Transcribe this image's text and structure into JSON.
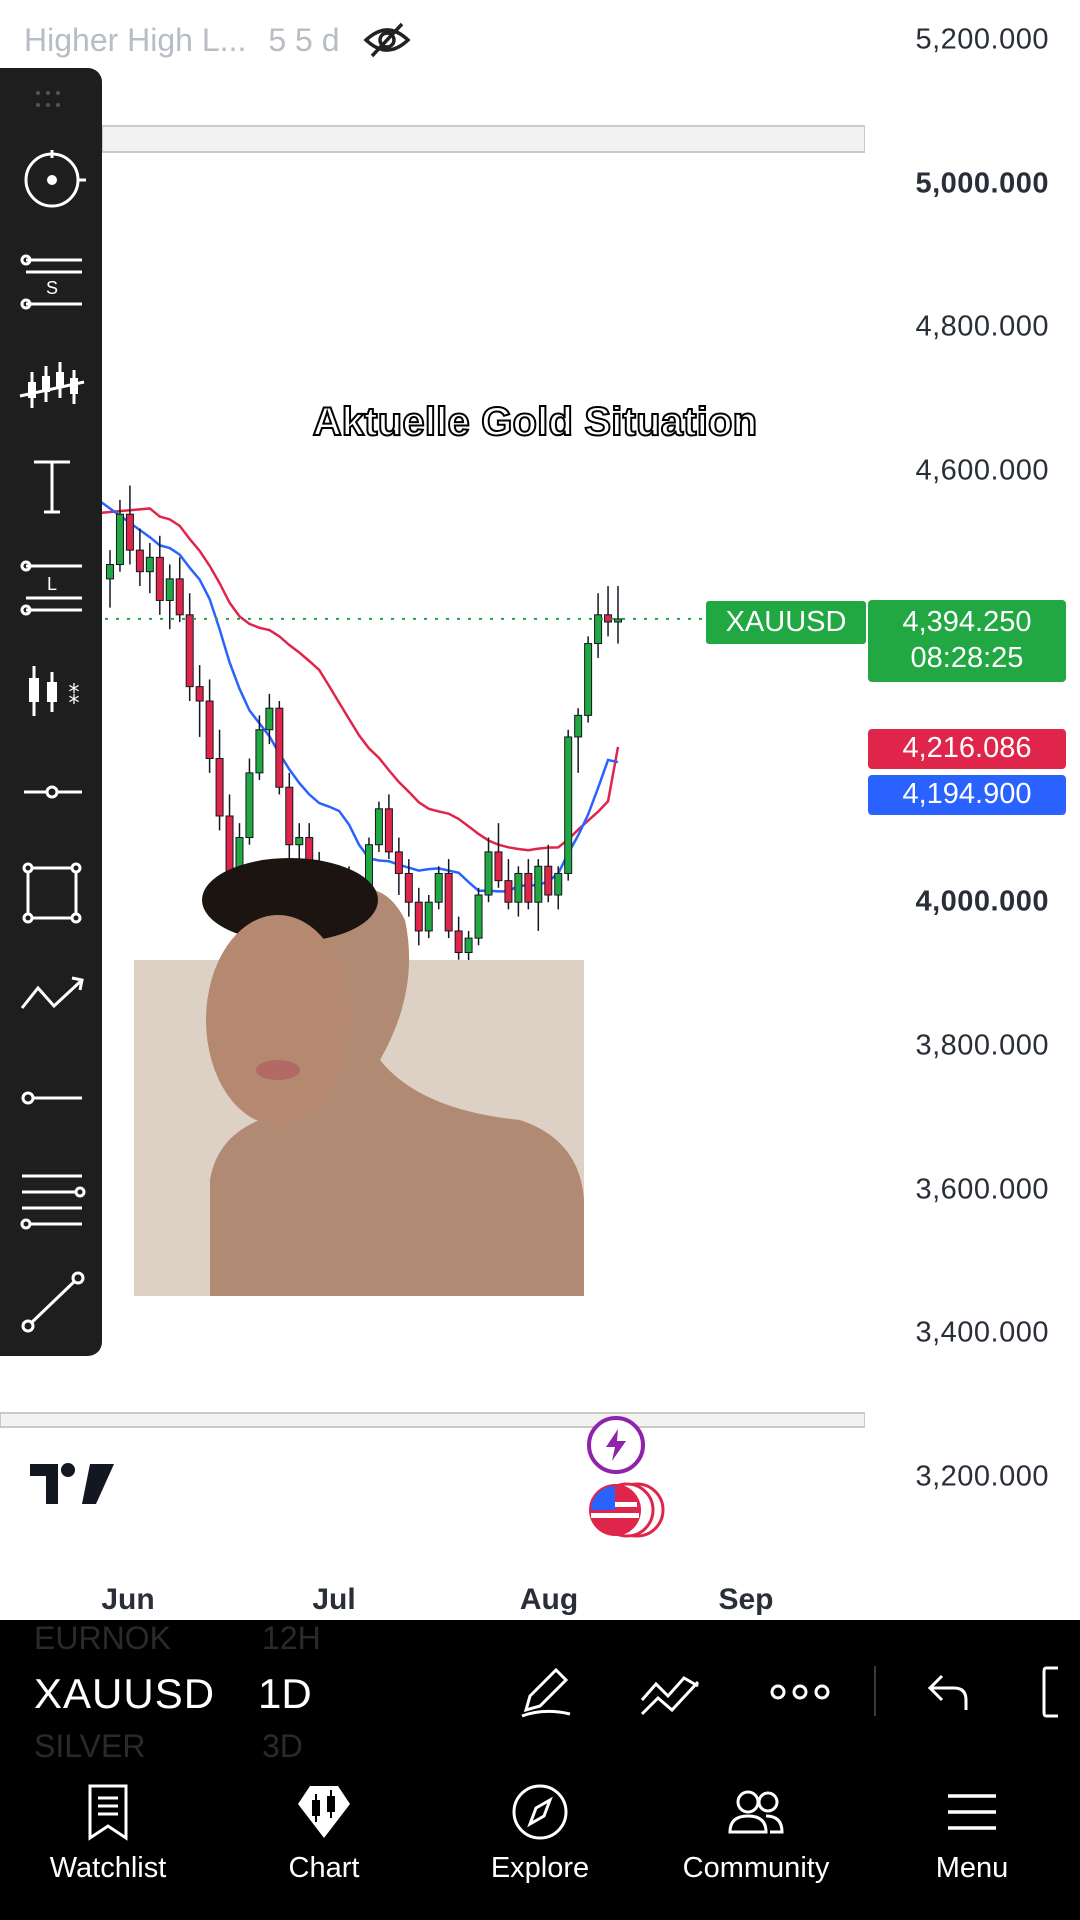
{
  "legend": {
    "name": "Higher High L...",
    "params": "5 5 d",
    "icon": "eye-off-icon"
  },
  "overlay_title": "Aktuelle Gold Situation",
  "price_axis": [
    {
      "label": "5,200.000",
      "bold": false,
      "value": 5200
    },
    {
      "label": "5,000.000",
      "bold": true,
      "value": 5000
    },
    {
      "label": "4,800.000",
      "bold": false,
      "value": 4800
    },
    {
      "label": "4,600.000",
      "bold": false,
      "value": 4600
    },
    {
      "label": "4,000.000",
      "bold": true,
      "value": 4000
    },
    {
      "label": "3,800.000",
      "bold": false,
      "value": 3800
    },
    {
      "label": "3,600.000",
      "bold": false,
      "value": 3600
    },
    {
      "label": "3,400.000",
      "bold": false,
      "value": 3400
    },
    {
      "label": "3,200.000",
      "bold": false,
      "value": 3200
    }
  ],
  "price_tags": {
    "symbol": "XAUUSD",
    "last_price": "4,394.250",
    "countdown": "08:28:25",
    "ma_red": "4,216.086",
    "ma_blue": "4,194.900"
  },
  "time_axis": [
    "Jun",
    "Jul",
    "Aug",
    "Sep"
  ],
  "toolbar_icons": [
    "cursor-icon",
    "sma-settings-icon",
    "candles-icon",
    "text-icon",
    "long-position-icon",
    "indicators-icon",
    "horizontal-ray-icon",
    "rectangle-icon",
    "path-icon",
    "horizontal-line-icon",
    "fib-icon",
    "trend-line-icon"
  ],
  "bottom_bar": {
    "symbol": "XAUUSD",
    "interval": "1D",
    "ghost_prev_symbol": "EURNOK",
    "ghost_prev_interval": "12H",
    "ghost_next_symbol": "SILVER",
    "ghost_next_interval": "3D"
  },
  "nav": [
    {
      "label": "Watchlist",
      "icon": "watchlist-icon"
    },
    {
      "label": "Chart",
      "icon": "chart-icon"
    },
    {
      "label": "Explore",
      "icon": "compass-icon"
    },
    {
      "label": "Community",
      "icon": "community-icon"
    },
    {
      "label": "Menu",
      "icon": "menu-icon"
    }
  ],
  "colors": {
    "up": "#22a843",
    "down": "#e0254a",
    "ma_red": "#e0254a",
    "ma_blue": "#2962ff"
  },
  "chart_data": {
    "type": "candlestick",
    "symbol": "XAUUSD",
    "interval": "1D",
    "title": "",
    "xlabel": "",
    "ylabel": "",
    "x_ticks": [
      "Jun",
      "Jul",
      "Aug",
      "Sep"
    ],
    "ylim": [
      3150,
      5250
    ],
    "last_price": 4394.25,
    "series": [
      {
        "type": "candles",
        "ohlc": [
          [
            4450,
            4490,
            4410,
            4470
          ],
          [
            4470,
            4560,
            4460,
            4540
          ],
          [
            4540,
            4580,
            4470,
            4490
          ],
          [
            4490,
            4520,
            4440,
            4460
          ],
          [
            4460,
            4500,
            4430,
            4480
          ],
          [
            4480,
            4510,
            4400,
            4420
          ],
          [
            4420,
            4470,
            4380,
            4450
          ],
          [
            4450,
            4480,
            4390,
            4400
          ],
          [
            4400,
            4430,
            4280,
            4300
          ],
          [
            4300,
            4330,
            4230,
            4280
          ],
          [
            4280,
            4310,
            4180,
            4200
          ],
          [
            4200,
            4240,
            4100,
            4120
          ],
          [
            4120,
            4150,
            4010,
            4030
          ],
          [
            4030,
            4110,
            4020,
            4090
          ],
          [
            4090,
            4200,
            4080,
            4180
          ],
          [
            4180,
            4260,
            4170,
            4240
          ],
          [
            4240,
            4290,
            4220,
            4270
          ],
          [
            4270,
            4280,
            4150,
            4160
          ],
          [
            4160,
            4180,
            4060,
            4080
          ],
          [
            4080,
            4110,
            4050,
            4090
          ],
          [
            4090,
            4110,
            4020,
            4040
          ],
          [
            4040,
            4070,
            3990,
            4000
          ],
          [
            4000,
            4010,
            3960,
            3980
          ],
          [
            3980,
            4040,
            3970,
            4030
          ],
          [
            4030,
            4050,
            3980,
            3990
          ],
          [
            3990,
            4000,
            3950,
            3960
          ],
          [
            3960,
            4090,
            3950,
            4080
          ],
          [
            4080,
            4140,
            4070,
            4130
          ],
          [
            4130,
            4150,
            4060,
            4070
          ],
          [
            4070,
            4090,
            4010,
            4040
          ],
          [
            4040,
            4060,
            3980,
            4000
          ],
          [
            4000,
            4020,
            3940,
            3960
          ],
          [
            3960,
            4010,
            3950,
            4000
          ],
          [
            4000,
            4050,
            3990,
            4040
          ],
          [
            4040,
            4060,
            3950,
            3960
          ],
          [
            3960,
            3980,
            3920,
            3930
          ],
          [
            3930,
            3960,
            3910,
            3950
          ],
          [
            3950,
            4020,
            3940,
            4010
          ],
          [
            4010,
            4090,
            4000,
            4070
          ],
          [
            4070,
            4110,
            4020,
            4030
          ],
          [
            4030,
            4060,
            3990,
            4000
          ],
          [
            4000,
            4050,
            3980,
            4040
          ],
          [
            4040,
            4060,
            3990,
            4000
          ],
          [
            4000,
            4060,
            3960,
            4050
          ],
          [
            4050,
            4080,
            4000,
            4010
          ],
          [
            4010,
            4050,
            3990,
            4040
          ],
          [
            4040,
            4240,
            4030,
            4230
          ],
          [
            4230,
            4270,
            4180,
            4260
          ],
          [
            4260,
            4370,
            4250,
            4360
          ],
          [
            4360,
            4430,
            4340,
            4400
          ],
          [
            4400,
            4440,
            4370,
            4390
          ],
          [
            4390,
            4440,
            4360,
            4394.25
          ]
        ]
      },
      {
        "type": "line",
        "color": "#e0254a",
        "start": 4540,
        "end": 4216.086
      },
      {
        "type": "line",
        "color": "#2962ff",
        "start": 4560,
        "end": 4194.9
      }
    ]
  }
}
